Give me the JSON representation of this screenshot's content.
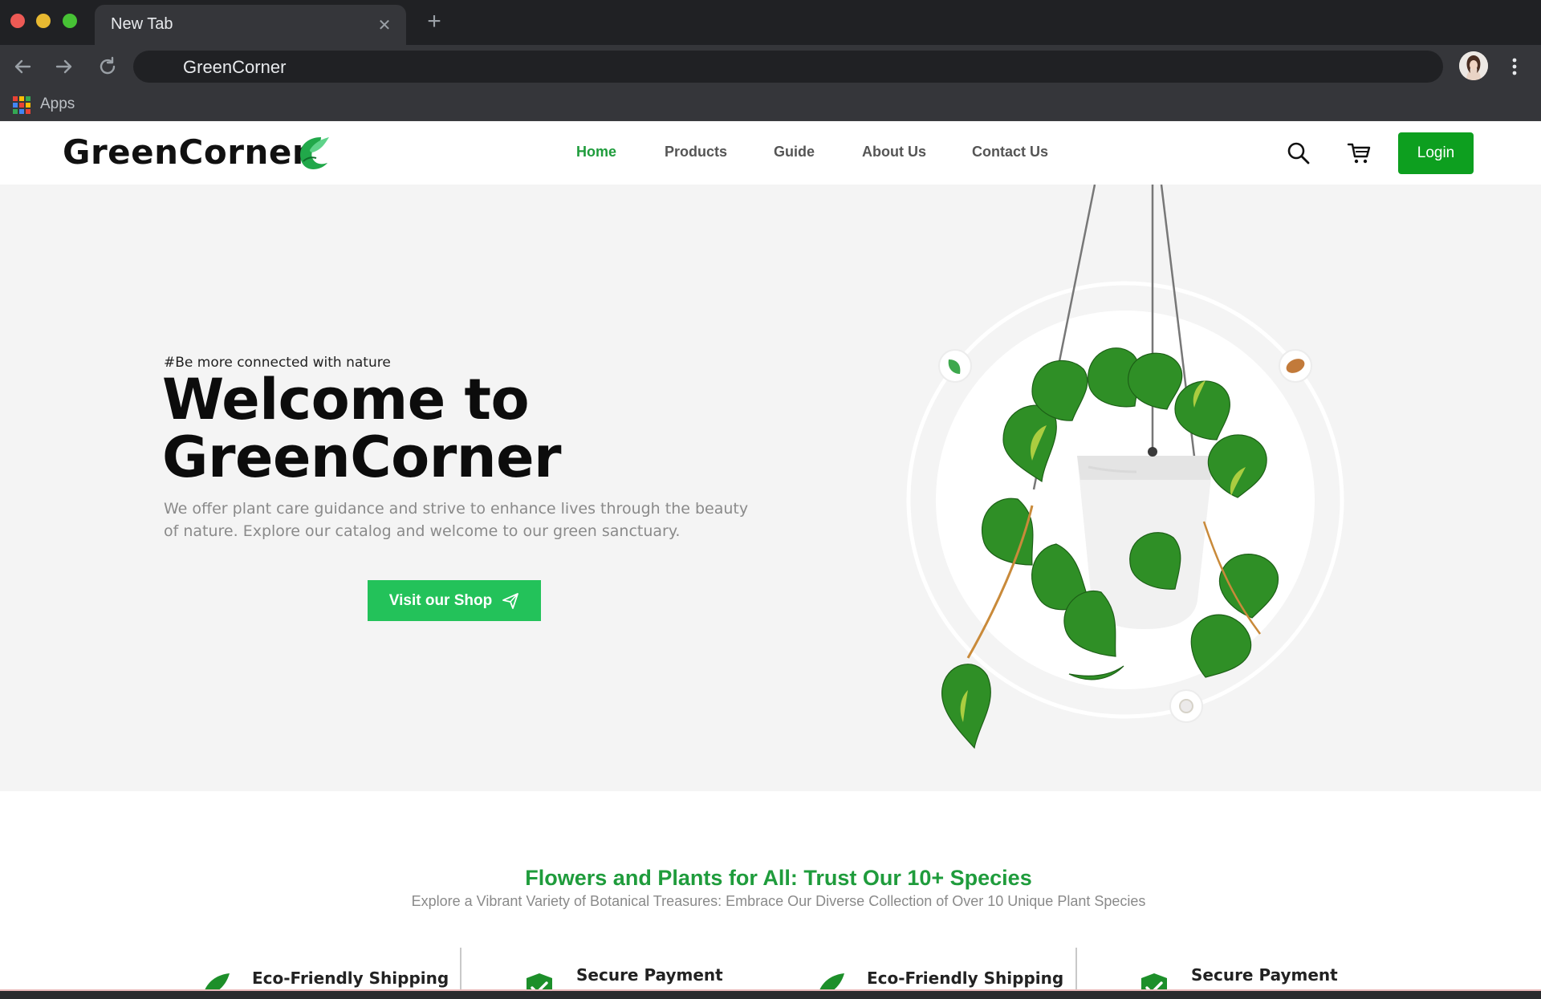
{
  "browser": {
    "tab_title": "New Tab",
    "tab_close_icon": "close-icon",
    "new_tab_icon": "plus-icon",
    "address": "GreenCorner",
    "bookmarks": {
      "apps_label": "Apps"
    }
  },
  "site": {
    "brand": "GreenCorner",
    "nav": [
      {
        "label": "Home",
        "active": true
      },
      {
        "label": "Products",
        "active": false
      },
      {
        "label": "Guide",
        "active": false
      },
      {
        "label": "About Us",
        "active": false
      },
      {
        "label": "Contact Us",
        "active": false
      }
    ],
    "login_label": "Login",
    "accent_color": "#1f9c3c",
    "button_color": "#23c25a"
  },
  "hero": {
    "tagline": "#Be more connected with nature",
    "title_line1": "Welcome to",
    "title_line2": "GreenCorner",
    "description": "We offer plant care guidance and strive to enhance lives through the beauty of nature. Explore our catalog and welcome to our green sanctuary.",
    "cta_label": "Visit our Shop"
  },
  "species": {
    "title": "Flowers and Plants for All: Trust Our 10+ Species",
    "subtitle": "Explore a Vibrant Variety of Botanical Treasures: Embrace Our Diverse Collection of Over 10 Unique Plant Species"
  },
  "features": [
    {
      "label": "Eco-Friendly Shipping",
      "icon": "leaf-icon"
    },
    {
      "label": "Secure Payment",
      "icon": "shield-check-icon"
    },
    {
      "label": "Eco-Friendly Shipping",
      "icon": "leaf-icon"
    },
    {
      "label": "Secure Payment",
      "icon": "shield-check-icon"
    }
  ]
}
